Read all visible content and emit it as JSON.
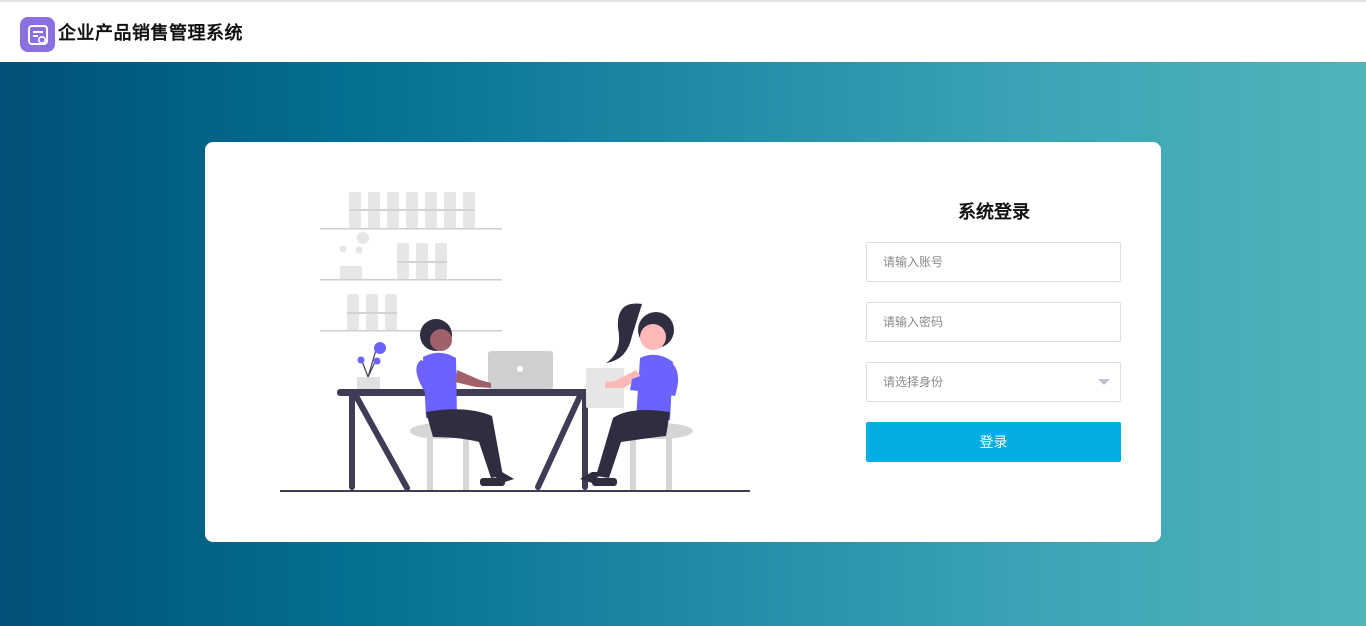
{
  "header": {
    "app_title": "企业产品销售管理系统",
    "logo_icon": "form-icon",
    "logo_color": "#8a6fe0"
  },
  "login": {
    "title": "系统登录",
    "account_placeholder": "请输入账号",
    "password_placeholder": "请输入密码",
    "role_placeholder": "请选择身份",
    "submit_label": "登录",
    "button_color": "#02ade3"
  },
  "illustration": {
    "icon": "office-workers-illustration",
    "accent_color": "#6c63ff"
  },
  "background": {
    "gradient_start": "#025077",
    "gradient_end": "#50b4bb"
  }
}
